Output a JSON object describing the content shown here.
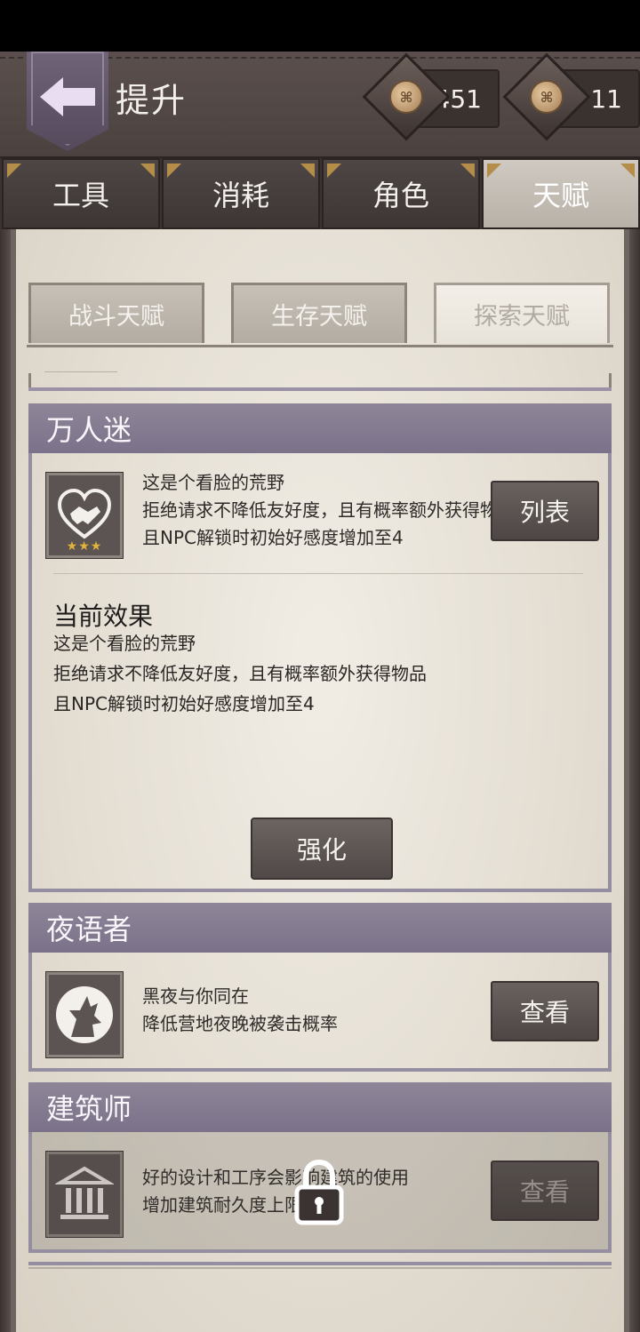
{
  "header": {
    "title": "提升",
    "currency_1": "451",
    "currency_2": "11"
  },
  "tabs": [
    "工具",
    "消耗",
    "角色",
    "天赋"
  ],
  "active_tab": "天赋",
  "subtabs": [
    "战斗天赋",
    "生存天赋",
    "探索天赋"
  ],
  "active_subtab": "探索天赋",
  "talents": [
    {
      "name": "万人迷",
      "icon": "handshake-heart-icon",
      "desc": [
        "这是个看脸的荒野",
        "拒绝请求不降低友好度，且有概率额外获得物",
        "且NPC解锁时初始好感度增加至4"
      ],
      "button": "列表",
      "stars": "★★★",
      "current_effect_title": "当前效果",
      "current_effect": [
        "这是个看脸的荒野",
        "拒绝请求不降低友好度，且有概率额外获得物品",
        "且NPC解锁时初始好感度增加至4"
      ],
      "upgrade_button": "强化"
    },
    {
      "name": "夜语者",
      "icon": "wolf-howl-icon",
      "desc": [
        "黑夜与你同在",
        "降低营地夜晚被袭击概率"
      ],
      "button": "查看"
    },
    {
      "name": "建筑师",
      "icon": "temple-building-icon",
      "desc": [
        "好的设计和工序会影响建筑的使用",
        "增加建筑耐久度上限"
      ],
      "button": "查看",
      "locked": true
    }
  ],
  "colors": {
    "header_bg": "#4b4240",
    "section_header": "#857c91",
    "parchment": "#e8e3da",
    "star": "#e0b33a"
  }
}
